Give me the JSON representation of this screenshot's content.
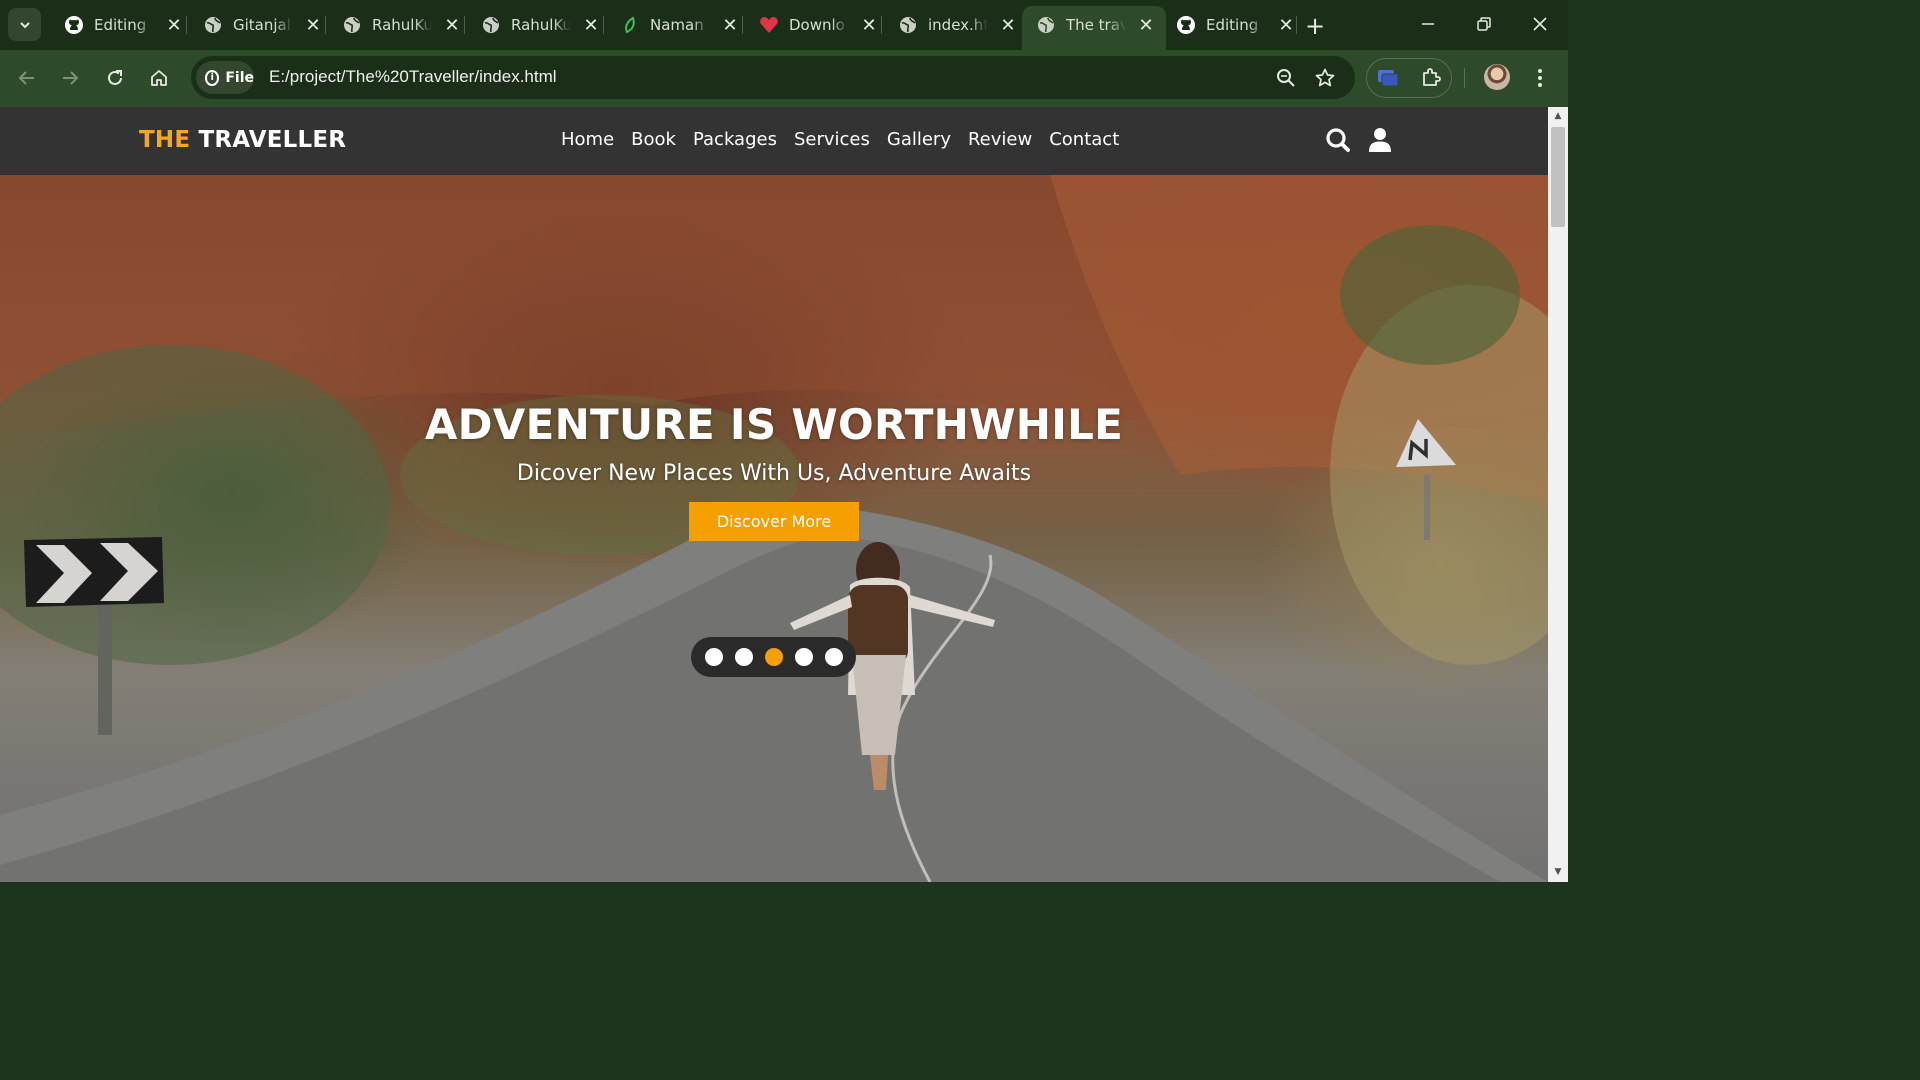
{
  "browser": {
    "tabs": [
      {
        "title": "Editing",
        "icon": "github-icon",
        "active": false
      },
      {
        "title": "Gitanjali",
        "icon": "globe-icon",
        "active": false
      },
      {
        "title": "RahulKu",
        "icon": "globe-icon",
        "active": false
      },
      {
        "title": "RahulKu",
        "icon": "globe-icon",
        "active": false
      },
      {
        "title": "Naman",
        "icon": "leaf-icon",
        "active": false
      },
      {
        "title": "Downlo",
        "icon": "heart-icon",
        "active": false
      },
      {
        "title": "index.ht",
        "icon": "globe-icon",
        "active": false
      },
      {
        "title": "The trav",
        "icon": "globe-icon",
        "active": true
      },
      {
        "title": "Editing",
        "icon": "github-icon",
        "active": false
      }
    ],
    "site_info_label": "File",
    "url": "E:/project/The%20Traveller/index.html"
  },
  "site": {
    "logo_accent": "THE",
    "logo_main": "TRAVELLER",
    "nav": [
      "Home",
      "Book",
      "Packages",
      "Services",
      "Gallery",
      "Review",
      "Contact"
    ],
    "hero": {
      "title": "ADVENTURE IS WORTHWHILE",
      "subtitle": "Dicover New Places With Us, Adventure Awaits",
      "cta": "Discover More",
      "slides": 5,
      "active_slide": 3
    }
  },
  "colors": {
    "accent": "#f5a623",
    "header_bg": "#333333",
    "browser_frame": "#2d4a2b"
  }
}
